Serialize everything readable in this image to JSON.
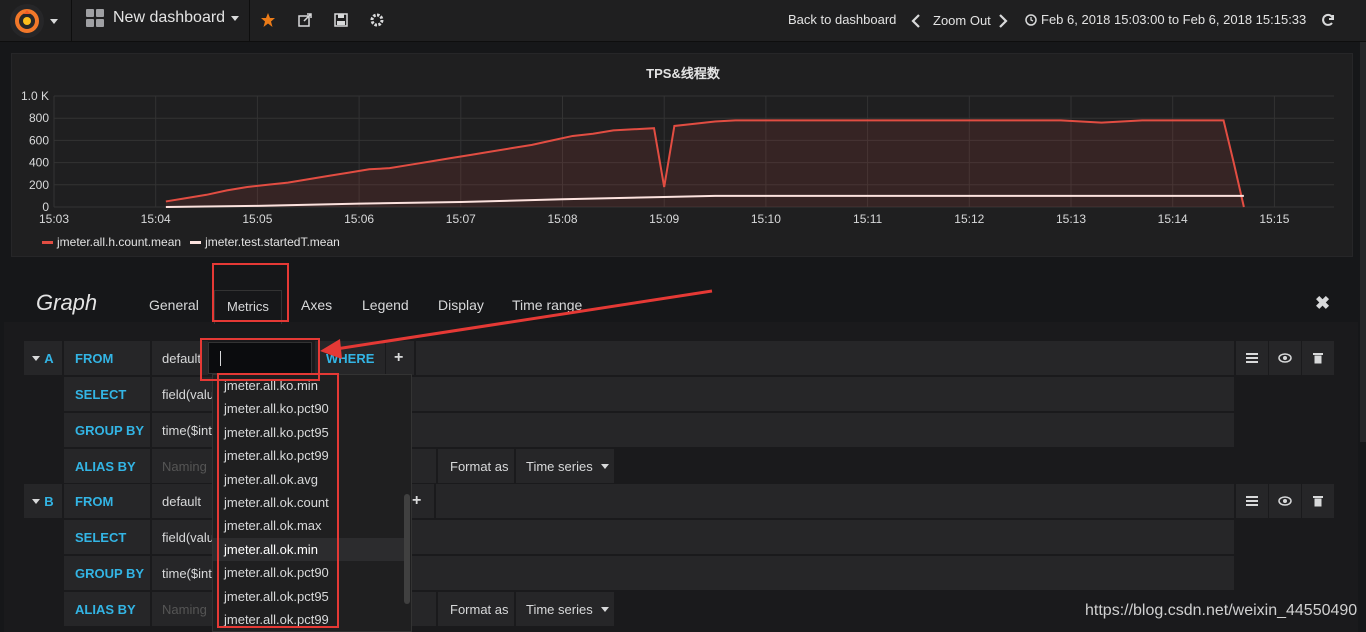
{
  "topnav": {
    "dashboard_title": "New dashboard",
    "back_to_dashboard": "Back to dashboard",
    "zoom_out": "Zoom Out",
    "time_range": "Feb 6, 2018 15:03:00 to Feb 6, 2018 15:15:33",
    "icons": [
      "grafana-logo-icon",
      "dashboard-grid-icon",
      "star-icon",
      "share-icon",
      "save-icon",
      "settings-icon",
      "chevron-left-icon",
      "chevron-right-icon",
      "clock-icon",
      "refresh-icon"
    ]
  },
  "panel": {
    "title": "TPS&线程数",
    "legend": [
      {
        "name": "jmeter.all.h.count.mean",
        "color": "#e24d42"
      },
      {
        "name": "jmeter.test.startedT.mean",
        "color": "#fce2de"
      }
    ]
  },
  "chart_data": {
    "type": "line",
    "title": "TPS&线程数",
    "x_ticks": [
      "15:03",
      "15:04",
      "15:05",
      "15:06",
      "15:07",
      "15:08",
      "15:09",
      "15:10",
      "15:11",
      "15:12",
      "15:13",
      "15:14",
      "15:15"
    ],
    "y_ticks": [
      "0",
      "200",
      "400",
      "600",
      "800",
      "1.0 K"
    ],
    "ylim": [
      0,
      1000
    ],
    "grid": true,
    "legend_position": "bottom-left",
    "series": [
      {
        "name": "jmeter.all.h.count.mean",
        "color": "#e24d42",
        "fill": true,
        "x": [
          4.1,
          4.3,
          4.5,
          4.7,
          4.9,
          5.1,
          5.3,
          5.5,
          5.7,
          5.9,
          6.1,
          6.3,
          6.5,
          6.7,
          6.9,
          7.1,
          7.3,
          7.5,
          7.7,
          7.9,
          8.1,
          8.3,
          8.5,
          8.7,
          8.9,
          9.0,
          9.1,
          9.3,
          9.5,
          9.7,
          9.9,
          10.1,
          10.3,
          10.5,
          10.7,
          10.9,
          11.1,
          11.3,
          11.5,
          11.7,
          11.9,
          12.1,
          12.3,
          12.5,
          12.7,
          12.9,
          13.1,
          13.3,
          13.5,
          13.7,
          13.9,
          14.1,
          14.3,
          14.5,
          14.6,
          14.7
        ],
        "values": [
          50,
          80,
          110,
          150,
          180,
          200,
          220,
          250,
          280,
          310,
          340,
          350,
          380,
          410,
          440,
          470,
          500,
          530,
          560,
          600,
          640,
          660,
          690,
          700,
          710,
          180,
          730,
          750,
          770,
          780,
          780,
          780,
          780,
          780,
          780,
          780,
          780,
          780,
          780,
          780,
          780,
          780,
          780,
          780,
          780,
          780,
          770,
          760,
          770,
          780,
          780,
          780,
          780,
          780,
          400,
          0
        ]
      },
      {
        "name": "jmeter.test.startedT.mean",
        "color": "#fce2de",
        "fill": false,
        "x": [
          4.1,
          5.0,
          6.0,
          7.0,
          8.0,
          9.0,
          9.5,
          10.0,
          11.0,
          12.0,
          13.0,
          14.0,
          14.7
        ],
        "values": [
          0,
          10,
          30,
          45,
          70,
          90,
          100,
          100,
          100,
          100,
          100,
          100,
          100
        ]
      }
    ]
  },
  "editor": {
    "title": "Graph",
    "tabs": [
      "General",
      "Metrics",
      "Axes",
      "Legend",
      "Display",
      "Time range"
    ],
    "active_tab": "Metrics"
  },
  "queries": [
    {
      "letter": "A",
      "from_kw": "FROM",
      "from_value": "default",
      "where_kw": "WHERE",
      "plus": "+",
      "select_kw": "SELECT",
      "select_value": "field(valu",
      "groupby_kw": "GROUP BY",
      "groupby_value": "time($inte",
      "alias_kw": "ALIAS BY",
      "alias_placeholder": "Naming",
      "format_label": "Format as",
      "format_value": "Time series"
    },
    {
      "letter": "B",
      "from_kw": "FROM",
      "from_value": "default",
      "plus": "+",
      "select_kw": "SELECT",
      "select_value": "field(valu",
      "groupby_kw": "GROUP BY",
      "groupby_value": "time($inte",
      "alias_kw": "ALIAS BY",
      "alias_placeholder": "Naming",
      "format_label": "Format as",
      "format_value": "Time series"
    }
  ],
  "dropdown": {
    "items": [
      "jmeter.all.ko.min",
      "jmeter.all.ko.pct90",
      "jmeter.all.ko.pct95",
      "jmeter.all.ko.pct99",
      "jmeter.all.ok.avg",
      "jmeter.all.ok.count",
      "jmeter.all.ok.max",
      "jmeter.all.ok.min",
      "jmeter.all.ok.pct90",
      "jmeter.all.ok.pct95",
      "jmeter.all.ok.pct99"
    ],
    "selected_index": 7
  },
  "watermark": "https://blog.csdn.net/weixin_44550490"
}
